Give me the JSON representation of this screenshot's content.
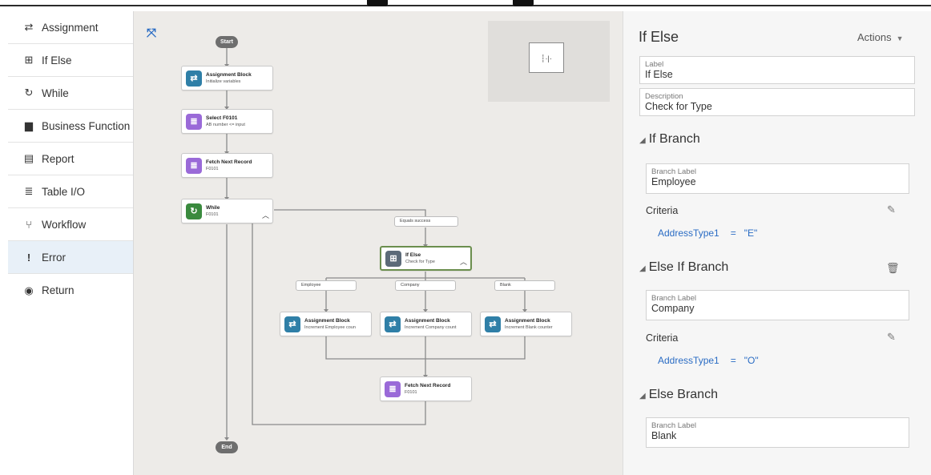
{
  "palette": {
    "items": [
      {
        "label": "Assignment",
        "icon": "swap-icon",
        "glyph": "⇄"
      },
      {
        "label": "If Else",
        "icon": "branch-icon",
        "glyph": "⊞"
      },
      {
        "label": "While",
        "icon": "loop-icon",
        "glyph": "↻"
      },
      {
        "label": "Business Function",
        "icon": "briefcase-icon",
        "glyph": "▆"
      },
      {
        "label": "Report",
        "icon": "document-icon",
        "glyph": "▤"
      },
      {
        "label": "Table I/O",
        "icon": "database-icon",
        "glyph": "≣"
      },
      {
        "label": "Workflow",
        "icon": "workflow-icon",
        "glyph": "⑂"
      },
      {
        "label": "Error",
        "icon": "exclamation-icon",
        "glyph": "!"
      },
      {
        "label": "Return",
        "icon": "return-icon",
        "glyph": "◉"
      }
    ],
    "selected": "Error"
  },
  "canvas": {
    "fit_icon": "⤧",
    "start_label": "Start",
    "end_label": "End",
    "nodes": {
      "assign1": {
        "title": "Assignment Block",
        "subtitle": "Initialize variables"
      },
      "select": {
        "title": "Select F0101",
        "subtitle": "AB number <= input"
      },
      "fetch1": {
        "title": "Fetch Next Record",
        "subtitle": "F0101"
      },
      "while": {
        "title": "While",
        "subtitle": "F0101"
      },
      "ifelse": {
        "title": "If Else",
        "subtitle": "Check for Type"
      },
      "assign_emp": {
        "title": "Assignment Block",
        "subtitle": "Increment Employee coun"
      },
      "assign_comp": {
        "title": "Assignment Block",
        "subtitle": "Increment Company count"
      },
      "assign_blank": {
        "title": "Assignment Block",
        "subtitle": "Increment Blank counter"
      },
      "fetch2": {
        "title": "Fetch Next Record",
        "subtitle": "F0101"
      }
    },
    "branch_labels": {
      "equals": "Equals success",
      "employee": "Employee",
      "company": "Company",
      "blank": "Blank"
    },
    "colors": {
      "assignment": "#2f7fa7",
      "database": "#9a6ad8",
      "while": "#3a8a3e",
      "ifelse": "#5c6a78",
      "selected_border": "#6b8e4e"
    }
  },
  "properties": {
    "title": "If Else",
    "actions_label": "Actions",
    "label_field": {
      "label": "Label",
      "value": "If Else"
    },
    "description_field": {
      "label": "Description",
      "value": "Check for Type"
    },
    "if_branch": {
      "heading": "If Branch",
      "branch_label": {
        "label": "Branch Label",
        "value": "Employee"
      },
      "criteria_label": "Criteria",
      "criteria": {
        "variable": "AddressType1",
        "operator": "=",
        "value": "\"E\""
      }
    },
    "else_if_branch": {
      "heading": "Else If Branch",
      "branch_label": {
        "label": "Branch Label",
        "value": "Company"
      },
      "criteria_label": "Criteria",
      "criteria": {
        "variable": "AddressType1",
        "operator": "=",
        "value": "\"O\""
      }
    },
    "else_branch": {
      "heading": "Else Branch",
      "branch_label": {
        "label": "Branch Label",
        "value": "Blank"
      }
    }
  }
}
